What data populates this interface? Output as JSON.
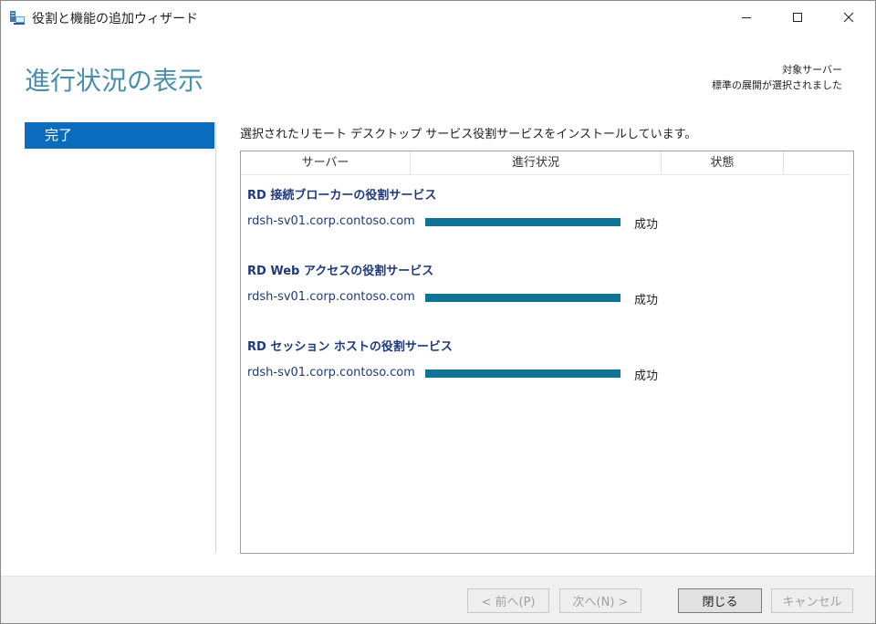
{
  "window": {
    "title": "役割と機能の追加ウィザード",
    "controls": {
      "minimize": "minimize-icon",
      "maximize": "maximize-icon",
      "close": "close-icon"
    }
  },
  "header": {
    "title": "進行状況の表示",
    "target_label": "対象サーバー",
    "target_value": "標準の展開が選択されました"
  },
  "nav": {
    "items": [
      {
        "label": "完了",
        "active": true
      }
    ]
  },
  "main": {
    "description": "選択されたリモート デスクトップ サービス役割サービスをインストールしています。",
    "columns": [
      "サーバー",
      "進行状況",
      "状態"
    ],
    "groups": [
      {
        "title": "RD 接続ブローカーの役割サービス",
        "rows": [
          {
            "server": "rdsh-sv01.corp.contoso.com",
            "progress": 1.0,
            "status": "成功"
          }
        ]
      },
      {
        "title": "RD Web アクセスの役割サービス",
        "rows": [
          {
            "server": "rdsh-sv01.corp.contoso.com",
            "progress": 1.0,
            "status": "成功"
          }
        ]
      },
      {
        "title": "RD セッション ホストの役割サービス",
        "rows": [
          {
            "server": "rdsh-sv01.corp.contoso.com",
            "progress": 1.0,
            "status": "成功"
          }
        ]
      }
    ]
  },
  "footer": {
    "prev_label": "< 前へ(P)",
    "next_label": "次へ(N) >",
    "close_label": "閉じる",
    "cancel_label": "キャンセル"
  },
  "colors": {
    "title_accent": "#4a8fae",
    "nav_active": "#0b6cbe",
    "progress_fill": "#0e7394",
    "group_text": "#1f3a7a"
  }
}
